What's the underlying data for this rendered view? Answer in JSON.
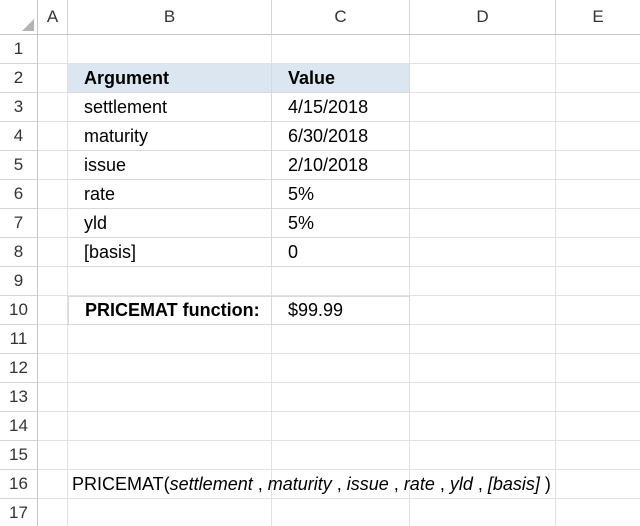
{
  "columns": [
    "A",
    "B",
    "C",
    "D",
    "E"
  ],
  "rows": [
    "1",
    "2",
    "3",
    "4",
    "5",
    "6",
    "7",
    "8",
    "9",
    "10",
    "11",
    "12",
    "13",
    "14",
    "15",
    "16",
    "17"
  ],
  "table": {
    "header": {
      "argument": "Argument",
      "value": "Value"
    },
    "rows": [
      {
        "argument": "settlement",
        "value": "4/15/2018"
      },
      {
        "argument": "maturity",
        "value": "6/30/2018"
      },
      {
        "argument": "issue",
        "value": "2/10/2018"
      },
      {
        "argument": "rate",
        "value": "5%"
      },
      {
        "argument": "yld",
        "value": "5%"
      },
      {
        "argument": "[basis]",
        "value": "0"
      }
    ]
  },
  "result": {
    "label": "PRICEMAT function:",
    "value": "$99.99"
  },
  "syntax": {
    "fn": "PRICEMAT(",
    "args": [
      "settlement",
      "maturity",
      "issue",
      "rate",
      "yld",
      "[basis]"
    ],
    "close": " )"
  },
  "colors": {
    "header_fill": "#dce6f1",
    "gridline": "#e1e1e1"
  }
}
